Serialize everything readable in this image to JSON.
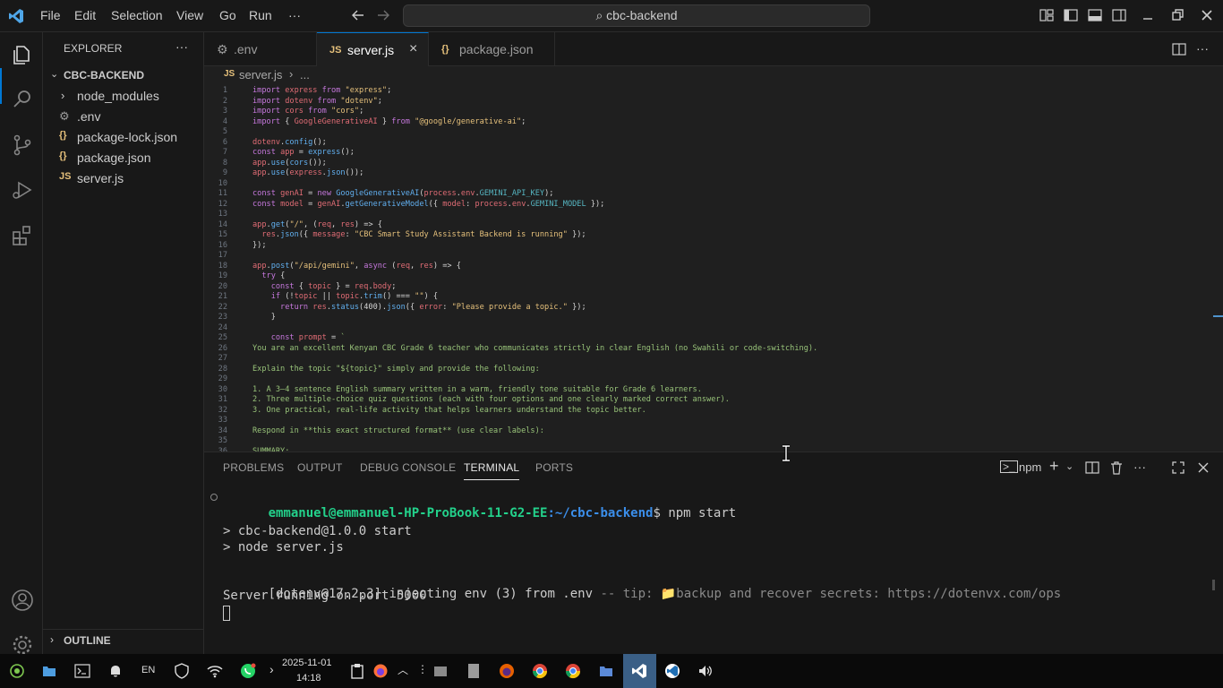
{
  "titlebar": {
    "menus": [
      "File",
      "Edit",
      "Selection",
      "View",
      "Go",
      "Run",
      "···"
    ],
    "search_text": "cbc-backend"
  },
  "sidebar": {
    "header": "EXPLORER",
    "project": "CBC-BACKEND",
    "items": [
      {
        "label": "node_modules",
        "icon": "chevron-right-icon"
      },
      {
        "label": ".env",
        "icon": "gear-icon"
      },
      {
        "label": "package-lock.json",
        "icon": "{}"
      },
      {
        "label": "package.json",
        "icon": "{}"
      },
      {
        "label": "server.js",
        "icon": "JS"
      }
    ],
    "outline": "OUTLINE"
  },
  "tabs": [
    {
      "label": ".env",
      "icon": "gear-icon"
    },
    {
      "label": "server.js",
      "icon": "JS",
      "active": true
    },
    {
      "label": "package.json",
      "icon": "{}"
    }
  ],
  "breadcrumb": {
    "file": "server.js",
    "rest": "..."
  },
  "code": [
    {
      "n": "1",
      "t": "import express from \"express\";"
    },
    {
      "n": "2",
      "t": "import dotenv from \"dotenv\";"
    },
    {
      "n": "3",
      "t": "import cors from \"cors\";"
    },
    {
      "n": "4",
      "t": "import { GoogleGenerativeAI } from \"@google/generative-ai\";"
    },
    {
      "n": "5",
      "t": ""
    },
    {
      "n": "6",
      "t": "dotenv.config();"
    },
    {
      "n": "7",
      "t": "const app = express();"
    },
    {
      "n": "8",
      "t": "app.use(cors());"
    },
    {
      "n": "9",
      "t": "app.use(express.json());"
    },
    {
      "n": "10",
      "t": ""
    },
    {
      "n": "11",
      "t": "const genAI = new GoogleGenerativeAI(process.env.GEMINI_API_KEY);"
    },
    {
      "n": "12",
      "t": "const model = genAI.getGenerativeModel({ model: process.env.GEMINI_MODEL });"
    },
    {
      "n": "13",
      "t": ""
    },
    {
      "n": "14",
      "t": "app.get(\"/\", (req, res) => {"
    },
    {
      "n": "15",
      "t": "  res.json({ message: \"CBC Smart Study Assistant Backend is running\" });"
    },
    {
      "n": "16",
      "t": "});"
    },
    {
      "n": "17",
      "t": ""
    },
    {
      "n": "18",
      "t": "app.post(\"/api/gemini\", async (req, res) => {"
    },
    {
      "n": "19",
      "t": "  try {"
    },
    {
      "n": "20",
      "t": "    const { topic } = req.body;"
    },
    {
      "n": "21",
      "t": "    if (!topic || topic.trim() === \"\") {"
    },
    {
      "n": "22",
      "t": "      return res.status(400).json({ error: \"Please provide a topic.\" });"
    },
    {
      "n": "23",
      "t": "    }"
    },
    {
      "n": "24",
      "t": ""
    },
    {
      "n": "25",
      "t": "    const prompt = `"
    },
    {
      "n": "26",
      "t": "You are an excellent Kenyan CBC Grade 6 teacher who communicates strictly in clear English (no Swahili or code-switching)."
    },
    {
      "n": "27",
      "t": ""
    },
    {
      "n": "28",
      "t": "Explain the topic \"${topic}\" simply and provide the following:"
    },
    {
      "n": "29",
      "t": ""
    },
    {
      "n": "30",
      "t": "1. A 3–4 sentence English summary written in a warm, friendly tone suitable for Grade 6 learners."
    },
    {
      "n": "31",
      "t": "2. Three multiple-choice quiz questions (each with four options and one clearly marked correct answer)."
    },
    {
      "n": "32",
      "t": "3. One practical, real-life activity that helps learners understand the topic better."
    },
    {
      "n": "33",
      "t": ""
    },
    {
      "n": "34",
      "t": "Respond in **this exact structured format** (use clear labels):"
    },
    {
      "n": "35",
      "t": ""
    },
    {
      "n": "36",
      "t": "SUMMARY:"
    }
  ],
  "panel": {
    "tabs": [
      "PROBLEMS",
      "OUTPUT",
      "DEBUG CONSOLE",
      "TERMINAL",
      "PORTS"
    ],
    "active_tab": "TERMINAL",
    "terminal_name": "npm",
    "prompt_user": "emmanuel@emmanuel-HP-ProBook-11-G2-EE",
    "prompt_path": ":~/cbc-backend",
    "prompt_cmd": "$ npm start",
    "lines": [
      "> cbc-backend@1.0.0 start",
      "> node server.js"
    ],
    "dotenv_prefix": "[dotenv@17.2.3] injecting env (3) from .env",
    "dotenv_tip": " -- tip: 📁backup and recover secrets: https://dotenvx.com/ops",
    "server_line": "Server running on port 5000"
  },
  "taskbar": {
    "lang": "EN",
    "date": "2025-11-01",
    "time": "14:18"
  },
  "colors": {
    "accent": "#0078d4",
    "prompt_green": "#23d18b",
    "path_blue": "#3b8eea"
  }
}
